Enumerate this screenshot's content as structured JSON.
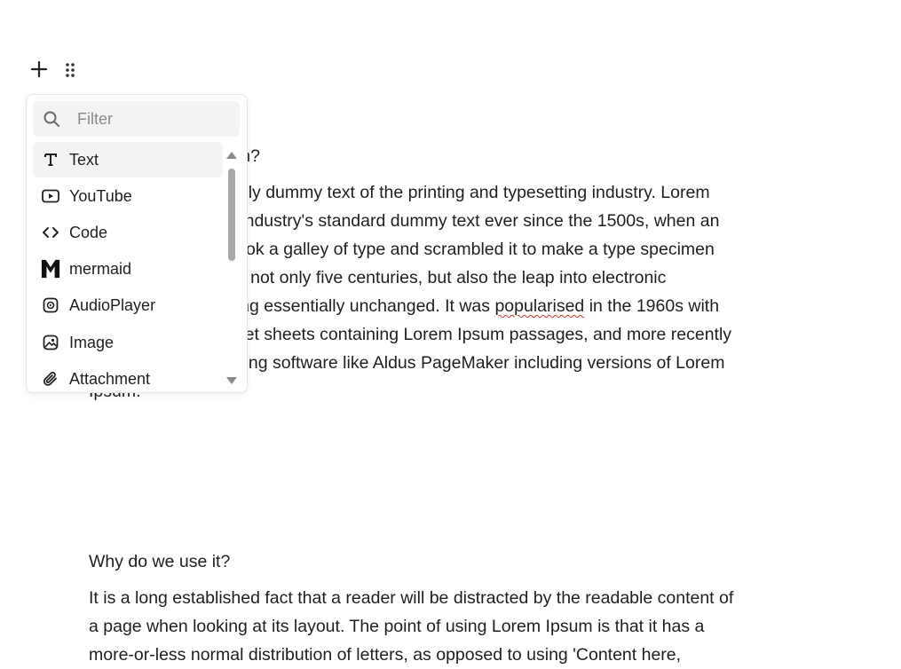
{
  "toolbar": {
    "add_icon": "plus-icon",
    "drag_icon": "drag-handle-icon"
  },
  "menu": {
    "filter_placeholder": "Filter",
    "items": [
      {
        "label": "Text",
        "icon": "text-icon"
      },
      {
        "label": "YouTube",
        "icon": "youtube-icon"
      },
      {
        "label": "Code",
        "icon": "code-icon"
      },
      {
        "label": "mermaid",
        "icon": "mermaid-icon"
      },
      {
        "label": "AudioPlayer",
        "icon": "audio-player-icon"
      },
      {
        "label": "Image",
        "icon": "image-icon"
      },
      {
        "label": "Attachment",
        "icon": "attachment-icon"
      }
    ]
  },
  "content": {
    "section1_heading_visible": "um?",
    "section1_lines": [
      "nply dummy text of the printing and typesetting industry. Lorem",
      "e industry's standard dummy text ever since the 1500s, when an",
      "ok a galley of type and scrambled it to make a type specimen",
      "ed not only five centuries, but also the leap into electronic",
      "ning essentially unchanged. It was ",
      "popularised",
      " in the 1960s with",
      "aset sheets containing Lorem Ipsum passages, and more recently",
      "shing software like Aldus PageMaker including versions of Lorem",
      "Ipsum."
    ],
    "section2_heading": "Why do we use it?",
    "section2_lines": [
      "It is a long established fact that a reader will be distracted by the readable content of",
      "a page when looking at its layout. The point of using Lorem Ipsum is that it has a",
      "more-or-less normal distribution of letters, as opposed to using 'Content here,"
    ]
  }
}
